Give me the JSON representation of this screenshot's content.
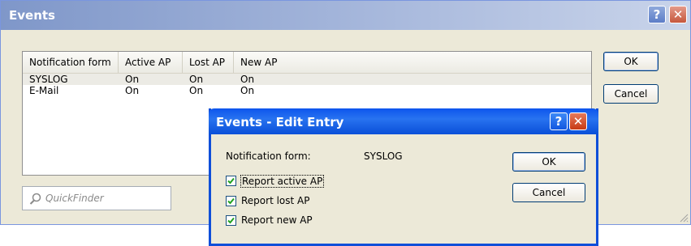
{
  "main_dialog": {
    "title": "Events",
    "help_symbol": "?",
    "close_symbol": "✕",
    "columns": [
      "Notification form",
      "Active AP",
      "Lost AP",
      "New AP"
    ],
    "rows": [
      [
        "SYSLOG",
        "On",
        "On",
        "On"
      ],
      [
        "E-Mail",
        "On",
        "On",
        "On"
      ]
    ],
    "quickfinder_placeholder": "QuickFinder",
    "ok_label": "OK",
    "cancel_label": "Cancel"
  },
  "edit_dialog": {
    "title": "Events - Edit Entry",
    "help_symbol": "?",
    "close_symbol": "✕",
    "notification_form_label": "Notification form:",
    "notification_form_value": "SYSLOG",
    "checkboxes": [
      {
        "label": "Report active AP",
        "checked": true
      },
      {
        "label": "Report lost AP",
        "checked": true
      },
      {
        "label": "Report new AP",
        "checked": true
      }
    ],
    "ok_label": "OK",
    "cancel_label": "Cancel"
  },
  "colors": {
    "title_text": "#ffffff",
    "dialog_bg": "#ece9d8",
    "xp_blue": "#0f4fd9",
    "check_green": "#21a121"
  }
}
